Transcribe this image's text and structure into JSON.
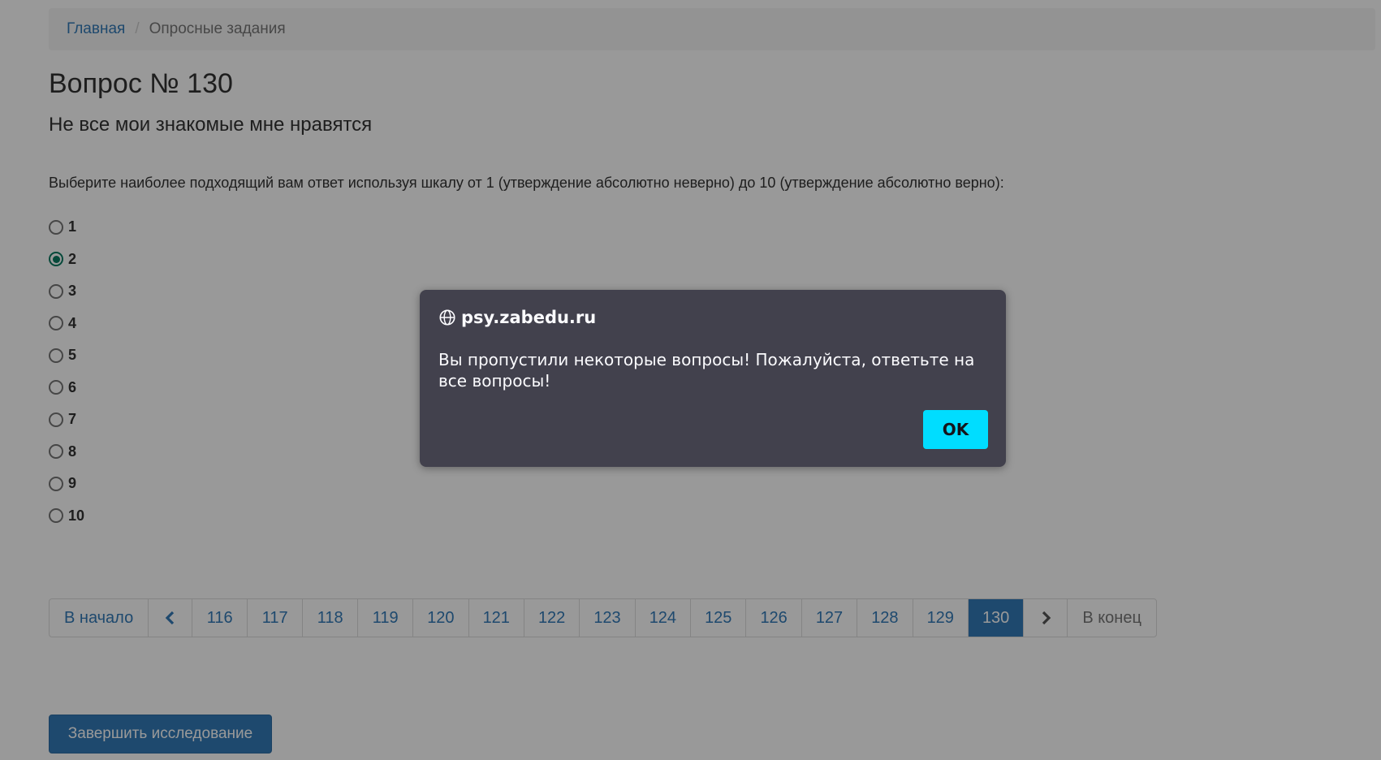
{
  "breadcrumb": {
    "home": "Главная",
    "separator": "/",
    "current": "Опросные задания"
  },
  "question": {
    "title": "Вопрос № 130",
    "text": "Не все мои знакомые мне нравятся",
    "instructions": "Выберите наиболее подходящий вам ответ используя шкалу от 1 (утверждение абсолютно неверно) до 10 (утверждение абсолютно верно):",
    "options": [
      "1",
      "2",
      "3",
      "4",
      "5",
      "6",
      "7",
      "8",
      "9",
      "10"
    ],
    "selected": "2"
  },
  "pagination": {
    "first": "В начало",
    "prev_icon": "chevron-left-icon",
    "pages": [
      "116",
      "117",
      "118",
      "119",
      "120",
      "121",
      "122",
      "123",
      "124",
      "125",
      "126",
      "127",
      "128",
      "129",
      "130"
    ],
    "active": "130",
    "next_icon": "chevron-right-icon",
    "last": "В конец"
  },
  "finish_button": "Завершить исследование",
  "dialog": {
    "origin": "psy.zabedu.ru",
    "origin_icon": "globe-icon",
    "message": "Вы пропустили некоторые вопросы! Пожалуйста, ответьте на все вопросы!",
    "ok": "OK"
  },
  "colors": {
    "link": "#337ab7",
    "dialog_bg": "#42414d",
    "ok_button": "#00ddff",
    "radio_checked": "#0a7a62"
  }
}
